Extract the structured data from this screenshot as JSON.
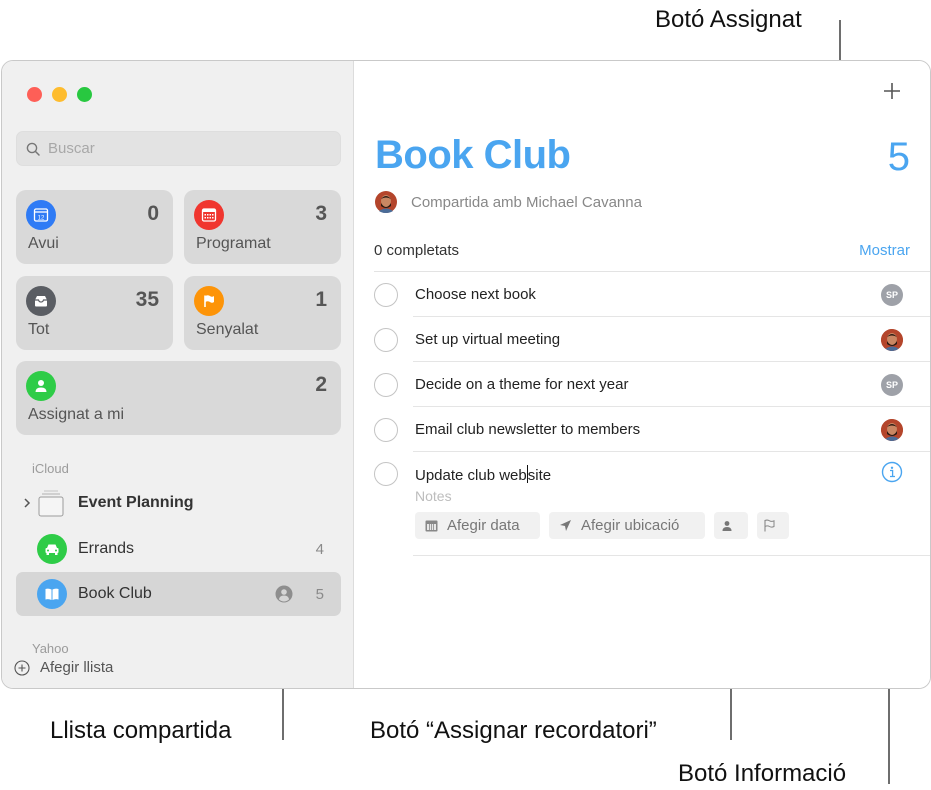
{
  "callouts": {
    "assigned_button": "Botó Assignat",
    "shared_list": "Llista compartida",
    "assign_reminder_button": "Botó “Assignar recordatori”",
    "info_button": "Botó Informació"
  },
  "sidebar": {
    "search": {
      "placeholder": "Buscar",
      "value": ""
    },
    "smart_lists": [
      {
        "label": "Avui",
        "count": "0",
        "icon": "calendar-today-icon",
        "color": "#2f7bf5"
      },
      {
        "label": "Programat",
        "count": "3",
        "icon": "calendar-scheduled-icon",
        "color": "#f0362f"
      },
      {
        "label": "Tot",
        "count": "35",
        "icon": "tray-icon",
        "color": "#5a5d63"
      },
      {
        "label": "Senyalat",
        "count": "1",
        "icon": "flag-icon",
        "color": "#fd9408"
      },
      {
        "label": "Assignat a mi",
        "count": "2",
        "icon": "person-icon",
        "color": "#2ecc47"
      }
    ],
    "sections": [
      {
        "name": "iCloud",
        "items": [
          {
            "label": "Event Planning",
            "type": "group",
            "icon": "folder-stack-icon"
          },
          {
            "label": "Errands",
            "count": "4",
            "icon": "car-icon",
            "color": "#2ecc47"
          },
          {
            "label": "Book Club",
            "count": "5",
            "icon": "book-icon",
            "color": "#4aa5f0",
            "shared": true,
            "selected": true
          }
        ]
      },
      {
        "name": "Yahoo",
        "items": []
      }
    ],
    "add_list_label": "Afegir llista"
  },
  "main": {
    "title": "Book Club",
    "total_count": "5",
    "shared_with": "Compartida amb Michael Cavanna",
    "completed_label": "0 completats",
    "show_label": "Mostrar",
    "accent_color": "#4aa5f0",
    "tasks": [
      {
        "text": "Choose next book",
        "assignee": "SP"
      },
      {
        "text": "Set up virtual meeting",
        "assignee": "Michael Cavanna"
      },
      {
        "text": "Decide on a theme for next year",
        "assignee": "SP"
      },
      {
        "text": "Email club newsletter to members",
        "assignee": "Michael Cavanna"
      },
      {
        "text_before_caret": "Update club web",
        "text_after_caret": "site",
        "editing": true
      }
    ],
    "notes_placeholder": "Notes",
    "chips": {
      "add_date": "Afegir data",
      "add_location": "Afegir ubicació"
    }
  }
}
